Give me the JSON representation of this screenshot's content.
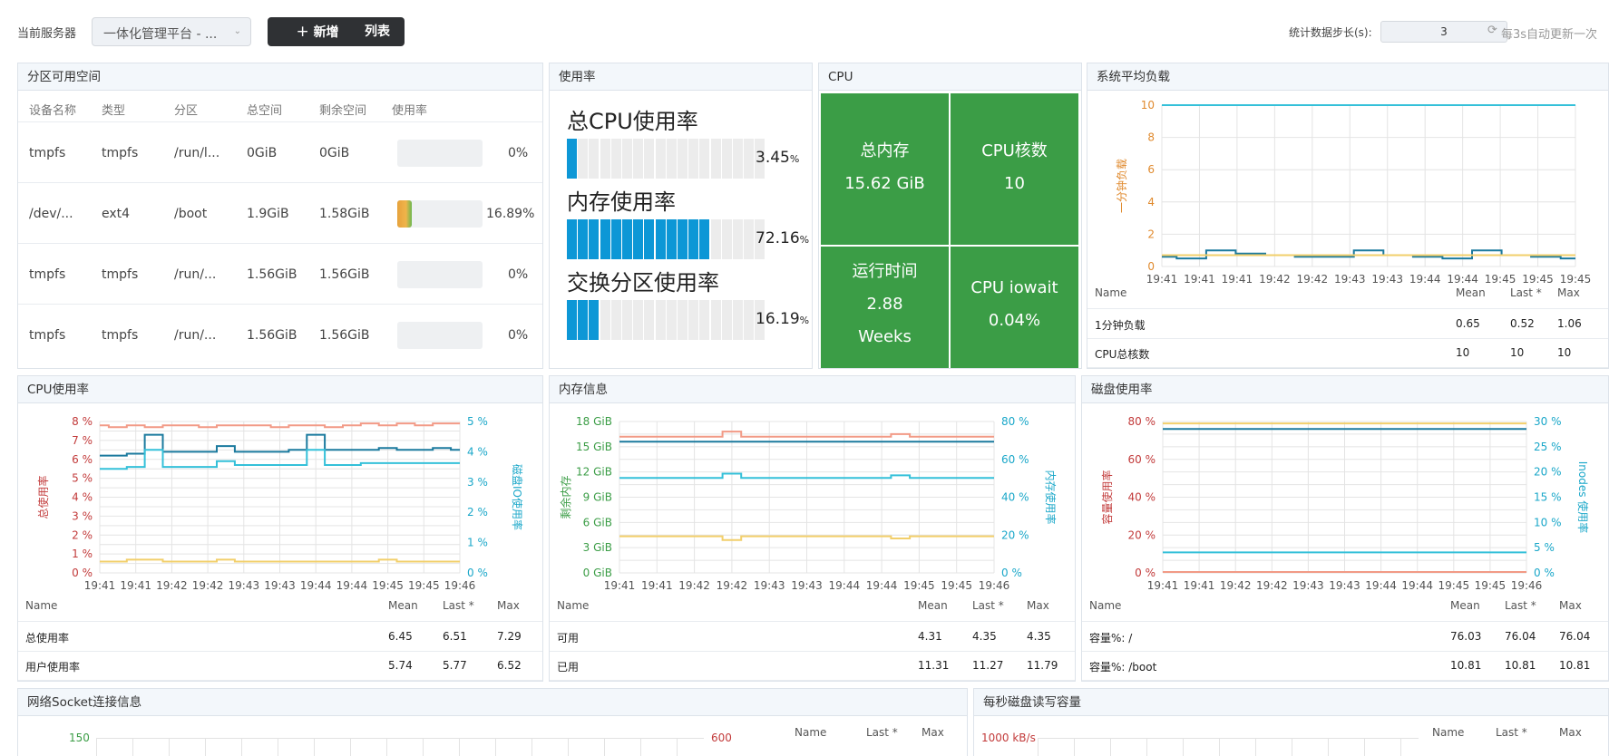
{
  "topbar": {
    "server_label": "当前服务器",
    "server_value": "一体化管理平台 - ...",
    "add_label": "新增",
    "list_label": "列表",
    "step_label": "统计数据步长(s):",
    "step_value": "3",
    "refresh_label": "每3s自动更新一次"
  },
  "partition": {
    "title": "分区可用空间",
    "headers": [
      "设备名称",
      "类型",
      "分区",
      "总空间",
      "剩余空间",
      "使用率"
    ],
    "rows": [
      {
        "device": "tmpfs",
        "type": "tmpfs",
        "mount": "/run/l...",
        "total": "0GiB",
        "free": "0GiB",
        "usage": "0%",
        "usage_value": 0
      },
      {
        "device": "/dev/...",
        "type": "ext4",
        "mount": "/boot",
        "total": "1.9GiB",
        "free": "1.58GiB",
        "usage": "16.89%",
        "usage_value": 16.89
      },
      {
        "device": "tmpfs",
        "type": "tmpfs",
        "mount": "/run/...",
        "total": "1.56GiB",
        "free": "1.56GiB",
        "usage": "0%",
        "usage_value": 0
      },
      {
        "device": "tmpfs",
        "type": "tmpfs",
        "mount": "/run/...",
        "total": "1.56GiB",
        "free": "1.56GiB",
        "usage": "0%",
        "usage_value": 0
      }
    ]
  },
  "usage": {
    "title": "使用率",
    "gauges": [
      {
        "label": "总CPU使用率",
        "value": "3.45",
        "unit": "%",
        "fraction": 0.0345
      },
      {
        "label": "内存使用率",
        "value": "72.16",
        "unit": "%",
        "fraction": 0.7216
      },
      {
        "label": "交换分区使用率",
        "value": "16.19",
        "unit": "%",
        "fraction": 0.1619
      }
    ]
  },
  "cpu_panel": {
    "title": "CPU",
    "cells": [
      {
        "label": "总内存",
        "value": "15.62 GiB"
      },
      {
        "label": "CPU核数",
        "value": "10"
      },
      {
        "label": "运行时间",
        "value": "2.88",
        "value2": "Weeks"
      },
      {
        "label": "CPU iowait",
        "value": "0.04%"
      }
    ],
    "color": "#3b9d46"
  },
  "load": {
    "title": "系统平均负载",
    "y_label": "一分钟负载",
    "x_ticks": [
      "19:41",
      "19:41",
      "19:41",
      "19:42",
      "19:42",
      "19:43",
      "19:43",
      "19:44",
      "19:44",
      "19:45",
      "19:45",
      "19:45"
    ],
    "y_ticks": [
      "0",
      "2",
      "4",
      "6",
      "8",
      "10"
    ],
    "legend_headers": [
      "Name",
      "Mean",
      "Last *",
      "Max"
    ],
    "legend_rows": [
      {
        "name": "1分钟负载",
        "mean": "0.65",
        "last": "0.52",
        "max": "1.06"
      },
      {
        "name": "CPU总核数",
        "mean": "10",
        "last": "10",
        "max": "10"
      }
    ]
  },
  "cpu_usage": {
    "title": "CPU使用率",
    "y_left_label": "总使用率",
    "y_right_label": "磁盘IO使用率",
    "y_left_ticks": [
      "0 %",
      "1 %",
      "2 %",
      "3 %",
      "4 %",
      "5 %",
      "6 %",
      "7 %",
      "8 %"
    ],
    "y_right_ticks": [
      "0 %",
      "1 %",
      "2 %",
      "3 %",
      "4 %",
      "5 %"
    ],
    "x_ticks": [
      "19:41",
      "19:41",
      "19:42",
      "19:42",
      "19:43",
      "19:43",
      "19:44",
      "19:44",
      "19:45",
      "19:45",
      "19:46"
    ],
    "legend_headers": [
      "Name",
      "Mean",
      "Last *",
      "Max"
    ],
    "legend_rows": [
      {
        "name": "总使用率",
        "mean": "6.45",
        "last": "6.51",
        "max": "7.29"
      },
      {
        "name": "用户使用率",
        "mean": "5.74",
        "last": "5.77",
        "max": "6.52"
      }
    ]
  },
  "memory": {
    "title": "内存信息",
    "y_left_label": "剩余内存",
    "y_right_label": "内存使用率",
    "y_left_ticks": [
      "0 GiB",
      "3 GiB",
      "6 GiB",
      "9 GiB",
      "12 GiB",
      "15 GiB",
      "18 GiB"
    ],
    "y_right_ticks": [
      "0 %",
      "20 %",
      "40 %",
      "60 %",
      "80 %"
    ],
    "x_ticks": [
      "19:41",
      "19:41",
      "19:42",
      "19:42",
      "19:43",
      "19:43",
      "19:44",
      "19:44",
      "19:45",
      "19:45",
      "19:46"
    ],
    "legend_headers": [
      "Name",
      "Mean",
      "Last *",
      "Max"
    ],
    "legend_rows": [
      {
        "name": "可用",
        "mean": "4.31",
        "last": "4.35",
        "max": "4.35"
      },
      {
        "name": "已用",
        "mean": "11.31",
        "last": "11.27",
        "max": "11.79"
      }
    ]
  },
  "disk": {
    "title": "磁盘使用率",
    "y_left_label": "容量使用率",
    "y_right_label": "Inodes 使用率",
    "y_left_ticks": [
      "0 %",
      "20 %",
      "40 %",
      "60 %",
      "80 %"
    ],
    "y_right_ticks": [
      "0 %",
      "5 %",
      "10 %",
      "15 %",
      "20 %",
      "25 %",
      "30 %"
    ],
    "x_ticks": [
      "19:41",
      "19:41",
      "19:42",
      "19:42",
      "19:43",
      "19:43",
      "19:44",
      "19:44",
      "19:45",
      "19:45",
      "19:46"
    ],
    "legend_headers": [
      "Name",
      "Mean",
      "Last *",
      "Max"
    ],
    "legend_rows": [
      {
        "name": "容量%: /",
        "mean": "76.03",
        "last": "76.04",
        "max": "76.04"
      },
      {
        "name": "容量%: /boot",
        "mean": "10.81",
        "last": "10.81",
        "max": "10.81"
      }
    ]
  },
  "socket": {
    "title": "网络Socket连接信息",
    "y_left_tick": "150",
    "y_right_tick": "600",
    "legend_headers": [
      "Name",
      "Last *",
      "Max"
    ]
  },
  "diskio": {
    "title": "每秒磁盘读写容量",
    "y_left_tick": "1000 kB/s",
    "legend_headers": [
      "Name",
      "Last *",
      "Max"
    ]
  },
  "chart_data": [
    {
      "type": "line",
      "title": "系统平均负载",
      "ylabel": "一分钟负载",
      "ylim": [
        0,
        10
      ],
      "x": [
        "19:41",
        "19:41",
        "19:41",
        "19:42",
        "19:42",
        "19:43",
        "19:43",
        "19:44",
        "19:44",
        "19:45",
        "19:45",
        "19:45"
      ],
      "series": [
        {
          "name": "1分钟负载",
          "color": "#1b7a9e",
          "values": [
            0.6,
            0.5,
            1.0,
            0.8,
            0.7,
            0.6,
            0.6,
            1.0,
            0.7,
            0.6,
            0.5,
            1.0,
            0.7,
            0.6,
            0.5
          ]
        },
        {
          "name": "CPU总核数",
          "color": "#34c0d9",
          "values": [
            10,
            10,
            10,
            10,
            10,
            10,
            10,
            10,
            10,
            10,
            10,
            10,
            10,
            10,
            10
          ]
        },
        {
          "color": "#f2cf6b",
          "values": [
            0.7,
            0.7,
            0.7,
            0.7,
            0.7,
            0.7,
            0.7,
            0.7,
            0.7,
            0.7,
            0.7,
            0.7,
            0.7,
            0.7,
            0.7
          ]
        }
      ]
    },
    {
      "type": "line",
      "title": "CPU使用率",
      "ylabel": "总使用率",
      "ylim": [
        0,
        8
      ],
      "y2label": "磁盘IO使用率",
      "y2lim": [
        0,
        5
      ],
      "x": [
        "19:41",
        "19:41",
        "19:42",
        "19:42",
        "19:43",
        "19:43",
        "19:44",
        "19:44",
        "19:45",
        "19:45",
        "19:46"
      ],
      "series": [
        {
          "color": "#f29a86",
          "values": [
            7.8,
            7.7,
            7.8,
            7.7,
            7.8,
            7.8,
            7.7,
            7.8,
            7.8,
            7.8,
            7.7,
            7.8,
            7.8,
            7.7,
            7.8,
            7.9,
            7.8,
            7.9,
            7.8,
            7.9,
            7.9
          ]
        },
        {
          "name": "总使用率",
          "color": "#1b7a9e",
          "values": [
            6.2,
            6.2,
            6.3,
            7.3,
            6.4,
            6.4,
            6.4,
            6.7,
            6.4,
            6.4,
            6.4,
            6.5,
            7.3,
            6.5,
            6.5,
            6.5,
            6.6,
            6.5,
            6.5,
            6.6,
            6.5
          ]
        },
        {
          "name": "用户使用率",
          "color": "#34c0d9",
          "values": [
            5.5,
            5.5,
            5.6,
            6.5,
            5.6,
            5.6,
            5.6,
            5.9,
            5.7,
            5.7,
            5.7,
            5.7,
            6.5,
            5.7,
            5.7,
            5.8,
            5.8,
            5.8,
            5.8,
            5.8,
            5.8
          ]
        },
        {
          "color": "#f2cf6b",
          "values": [
            0.6,
            0.6,
            0.7,
            0.7,
            0.6,
            0.6,
            0.6,
            0.7,
            0.6,
            0.6,
            0.6,
            0.6,
            0.6,
            0.6,
            0.6,
            0.6,
            0.7,
            0.6,
            0.6,
            0.6,
            0.6
          ]
        }
      ]
    },
    {
      "type": "line",
      "title": "内存信息",
      "ylabel": "剩余内存",
      "ylim": [
        0,
        18
      ],
      "y2label": "内存使用率",
      "y2lim": [
        0,
        80
      ],
      "x": [
        "19:41",
        "19:41",
        "19:42",
        "19:42",
        "19:43",
        "19:43",
        "19:44",
        "19:44",
        "19:45",
        "19:45",
        "19:46"
      ],
      "series": [
        {
          "color": "#f29a86",
          "values": [
            16.2,
            16.2,
            16.2,
            16.2,
            16.2,
            16.2,
            16.8,
            16.2,
            16.2,
            16.2,
            16.2,
            16.2,
            16.2,
            16.2,
            16.2,
            16.5,
            16.2,
            16.2,
            16.2,
            16.2,
            16.2
          ]
        },
        {
          "color": "#1b7a9e",
          "values": [
            15.6,
            15.6,
            15.6,
            15.6,
            15.6,
            15.6,
            15.6,
            15.6,
            15.6,
            15.6,
            15.6,
            15.6,
            15.6,
            15.6,
            15.6,
            15.6,
            15.6,
            15.6,
            15.6,
            15.6,
            15.6
          ]
        },
        {
          "name": "已用",
          "color": "#34c0d9",
          "values": [
            11.3,
            11.3,
            11.3,
            11.3,
            11.3,
            11.3,
            11.8,
            11.3,
            11.3,
            11.3,
            11.3,
            11.3,
            11.3,
            11.3,
            11.3,
            11.6,
            11.3,
            11.3,
            11.3,
            11.3,
            11.3
          ]
        },
        {
          "name": "可用",
          "color": "#f2cf6b",
          "values": [
            4.35,
            4.35,
            4.35,
            4.35,
            4.35,
            4.35,
            3.9,
            4.35,
            4.35,
            4.35,
            4.35,
            4.35,
            4.35,
            4.35,
            4.35,
            4.1,
            4.35,
            4.35,
            4.35,
            4.35,
            4.35
          ]
        }
      ]
    },
    {
      "type": "line",
      "title": "磁盘使用率",
      "ylabel": "容量使用率",
      "ylim": [
        0,
        80
      ],
      "y2label": "Inodes 使用率",
      "y2lim": [
        0,
        30
      ],
      "x": [
        "19:41",
        "19:41",
        "19:42",
        "19:42",
        "19:43",
        "19:43",
        "19:44",
        "19:44",
        "19:45",
        "19:45",
        "19:46"
      ],
      "series": [
        {
          "color": "#f2cf6b",
          "values": [
            79,
            79,
            79,
            79,
            79,
            79,
            79,
            79,
            79,
            79,
            79
          ]
        },
        {
          "name": "容量%: /",
          "color": "#1b7a9e",
          "values": [
            76.04,
            76.04,
            76.04,
            76.04,
            76.04,
            76.04,
            76.04,
            76.04,
            76.04,
            76.04,
            76.04
          ]
        },
        {
          "name": "容量%: /boot",
          "color": "#34c0d9",
          "values": [
            10.81,
            10.81,
            10.81,
            10.81,
            10.81,
            10.81,
            10.81,
            10.81,
            10.81,
            10.81,
            10.81
          ]
        },
        {
          "color": "#f29a86",
          "values": [
            0.5,
            0.5,
            0.5,
            0.5,
            0.5,
            0.5,
            0.5,
            0.5,
            0.5,
            0.5,
            0.5
          ]
        }
      ]
    }
  ]
}
